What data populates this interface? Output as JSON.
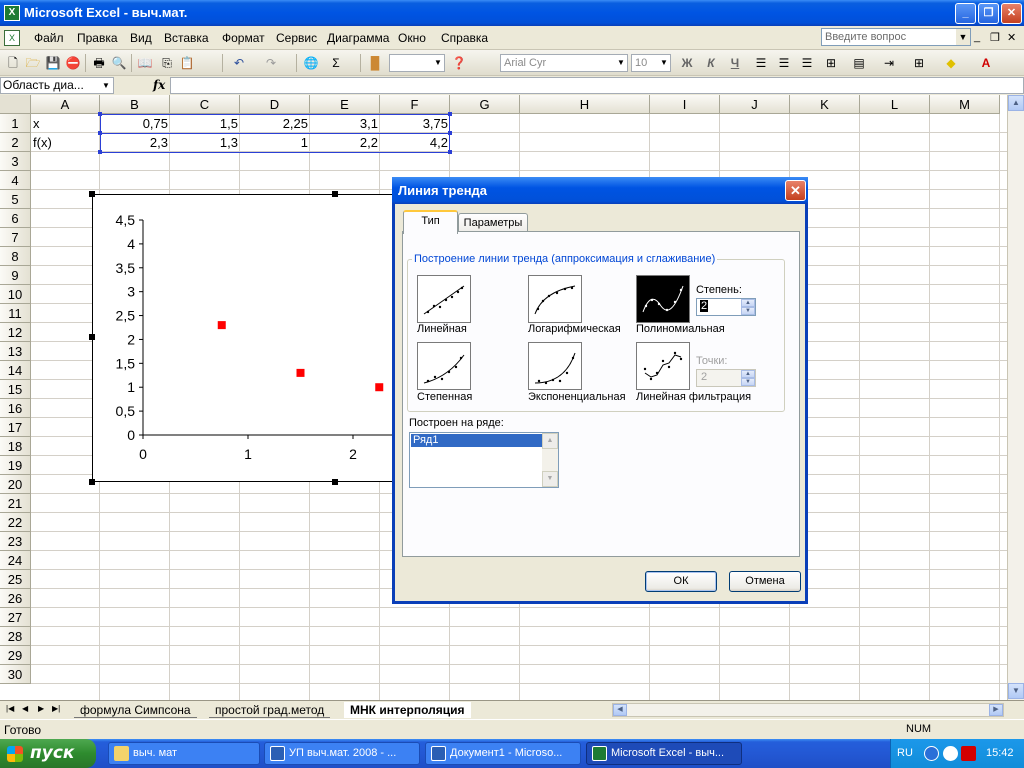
{
  "window": {
    "title": "Microsoft Excel - выч.мат."
  },
  "menu": {
    "items": [
      "Файл",
      "Правка",
      "Вид",
      "Вставка",
      "Формат",
      "Сервис",
      "Диаграмма",
      "Окно",
      "Справка"
    ],
    "help_placeholder": "Введите вопрос"
  },
  "toolbar": {
    "font_name": "Arial Cyr",
    "font_size": "10",
    "bold": "Ж",
    "italic": "К",
    "underline": "Ч",
    "sigma": "Σ"
  },
  "formula_bar": {
    "name_box": "Область диа...",
    "fx": "fx"
  },
  "sheet": {
    "columns": [
      "A",
      "B",
      "C",
      "D",
      "E",
      "F",
      "G",
      "H",
      "I",
      "J",
      "K",
      "L",
      "M"
    ],
    "rows": [
      "1",
      "2",
      "3",
      "4",
      "5",
      "6",
      "7",
      "8",
      "9",
      "10",
      "11",
      "12",
      "13",
      "14",
      "15",
      "16",
      "17",
      "18",
      "19",
      "20",
      "21",
      "22",
      "23",
      "24",
      "25",
      "26",
      "27",
      "28",
      "29",
      "30"
    ],
    "row1": [
      "x",
      "0,75",
      "1,5",
      "2,25",
      "3,1",
      "3,75"
    ],
    "row2": [
      "f(x)",
      "2,3",
      "1,3",
      "1",
      "2,2",
      "4,2"
    ]
  },
  "chart_data": {
    "type": "scatter",
    "x": [
      0.75,
      1.5,
      2.25
    ],
    "y": [
      2.3,
      1.3,
      1
    ],
    "xlim": [
      0,
      2.4
    ],
    "ylim": [
      0,
      4.5
    ],
    "y_ticks": [
      "4,5",
      "4",
      "3,5",
      "3",
      "2,5",
      "2",
      "1,5",
      "1",
      "0,5",
      "0"
    ],
    "x_ticks": [
      "0",
      "1",
      "2"
    ],
    "marker_color": "#ff0000",
    "grid": false
  },
  "dialog": {
    "title": "Линия тренда",
    "tabs": [
      "Тип",
      "Параметры"
    ],
    "group_label": "Построение линии тренда (аппроксимация и сглаживание)",
    "trend_types": [
      "Линейная",
      "Логарифмическая",
      "Полиномиальная",
      "Степенная",
      "Экспоненциальная",
      "Линейная фильтрация"
    ],
    "selected_type": "Полиномиальная",
    "degree_label": "Степень:",
    "degree_value": "2",
    "points_label": "Точки:",
    "points_value": "2",
    "series_label": "Построен на ряде:",
    "series_items": [
      "Ряд1"
    ],
    "ok": "ОК",
    "cancel": "Отмена"
  },
  "tabs_bar": {
    "sheets": [
      "формула Симпсона",
      "простой град.метод",
      "МНК интерполяция"
    ],
    "active": "МНК интерполяция"
  },
  "status": {
    "ready": "Готово",
    "num": "NUM"
  },
  "taskbar": {
    "start": "пуск",
    "items": [
      "выч. мат",
      "УП выч.мат. 2008 - ...",
      "Документ1 - Microso...",
      "Microsoft Excel - выч..."
    ],
    "lang": "RU",
    "time": "15:42"
  }
}
